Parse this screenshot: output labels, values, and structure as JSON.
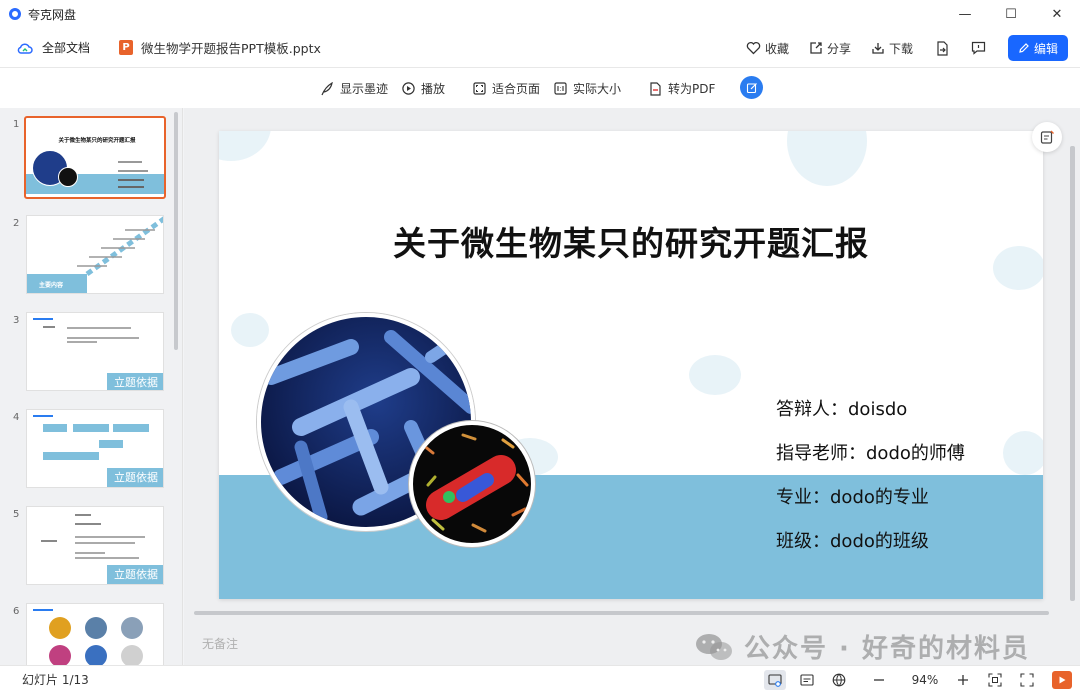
{
  "app": {
    "title": "夸克网盘"
  },
  "window_controls": {
    "minimize": "—",
    "maximize": "☐",
    "close": "✕"
  },
  "header": {
    "root_label": "全部文档",
    "file_name": "微生物学开题报告PPT模板.pptx",
    "file_type_badge": "P",
    "favorite_label": "收藏",
    "share_label": "分享",
    "download_label": "下载",
    "edit_label": "编辑"
  },
  "toolbar": {
    "show_ink": "显示墨迹",
    "play": "播放",
    "fit_page": "适合页面",
    "actual_size": "实际大小",
    "to_pdf": "转为PDF"
  },
  "sidebar": {
    "thumbnails": [
      {
        "num": "1",
        "title": "关于微生物某只的研究开题汇报"
      },
      {
        "num": "2",
        "title": "主要内容"
      },
      {
        "num": "3",
        "title": "立题依据"
      },
      {
        "num": "4",
        "title": "立题依据"
      },
      {
        "num": "5",
        "title": "立题依据"
      },
      {
        "num": "6",
        "title": ""
      }
    ]
  },
  "slide": {
    "title": "关于微生物某只的研究开题汇报",
    "lines": [
      "答辩人：doisdo",
      "指导老师：dodo的师傅",
      "专业：dodo的专业",
      "班级：dodo的班级"
    ]
  },
  "notes": {
    "placeholder": "无备注"
  },
  "watermark": {
    "text": "公众号 · 好奇的材料员"
  },
  "status": {
    "slide_counter": "幻灯片 1/13",
    "zoom": "94%"
  },
  "colors": {
    "accent": "#1967ff",
    "ppt_orange": "#e8632b",
    "slide_band": "#7fbfdc"
  }
}
